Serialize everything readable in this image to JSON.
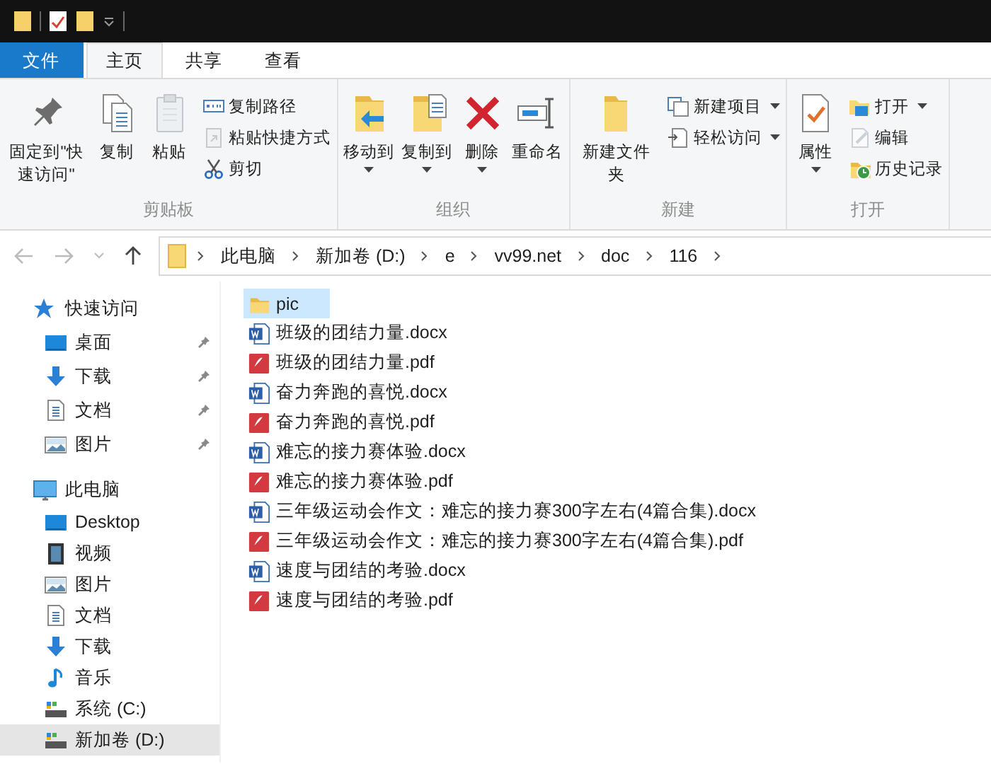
{
  "ribbon_tabs": [
    {
      "label": "文件",
      "kind": "menu",
      "selected": false
    },
    {
      "label": "主页",
      "kind": "tab",
      "selected": true
    },
    {
      "label": "共享",
      "kind": "tab",
      "selected": false
    },
    {
      "label": "查看",
      "kind": "tab",
      "selected": false
    }
  ],
  "ribbon_groups": [
    {
      "label": "剪贴板",
      "columns": [
        {
          "kind": "large",
          "items": [
            {
              "label": "固定到\"快速访问\"",
              "kind": "pin",
              "disabled": false,
              "dropdown": false
            }
          ]
        },
        {
          "kind": "large",
          "items": [
            {
              "label": "复制",
              "kind": "copy",
              "disabled": false,
              "dropdown": false
            }
          ]
        },
        {
          "kind": "large",
          "items": [
            {
              "label": "粘贴",
              "kind": "paste",
              "disabled": true,
              "dropdown": false
            }
          ]
        },
        {
          "kind": "stack",
          "items": [
            {
              "label": "复制路径",
              "kind": "copypath",
              "disabled": false,
              "dropdown": false
            },
            {
              "label": "粘贴快捷方式",
              "kind": "pasteshortcut",
              "disabled": true,
              "dropdown": false
            },
            {
              "label": "剪切",
              "kind": "cut",
              "disabled": false,
              "dropdown": false
            }
          ]
        }
      ]
    },
    {
      "label": "组织",
      "columns": [
        {
          "kind": "large",
          "items": [
            {
              "label": "移动到",
              "kind": "moveto",
              "disabled": false,
              "dropdown": true
            }
          ]
        },
        {
          "kind": "large",
          "items": [
            {
              "label": "复制到",
              "kind": "copyto",
              "disabled": false,
              "dropdown": true
            }
          ]
        },
        {
          "kind": "large",
          "items": [
            {
              "label": "删除",
              "kind": "delete",
              "disabled": false,
              "dropdown": true
            }
          ]
        },
        {
          "kind": "large",
          "items": [
            {
              "label": "重命名",
              "kind": "rename",
              "disabled": false,
              "dropdown": false
            }
          ]
        }
      ]
    },
    {
      "label": "新建",
      "columns": [
        {
          "kind": "large",
          "items": [
            {
              "label": "新建文件夹",
              "kind": "newfolder",
              "disabled": false,
              "dropdown": false
            }
          ]
        },
        {
          "kind": "stack",
          "items": [
            {
              "label": "新建项目",
              "kind": "newitem",
              "disabled": false,
              "dropdown": true
            },
            {
              "label": "轻松访问",
              "kind": "easyaccess",
              "disabled": false,
              "dropdown": true
            }
          ]
        }
      ]
    },
    {
      "label": "打开",
      "columns": [
        {
          "kind": "large",
          "items": [
            {
              "label": "属性",
              "kind": "properties",
              "disabled": false,
              "dropdown": true
            }
          ]
        },
        {
          "kind": "stack",
          "items": [
            {
              "label": "打开",
              "kind": "open",
              "disabled": false,
              "dropdown": true
            },
            {
              "label": "编辑",
              "kind": "edit",
              "disabled": true,
              "dropdown": false
            },
            {
              "label": "历史记录",
              "kind": "history",
              "disabled": false,
              "dropdown": false
            }
          ]
        }
      ]
    }
  ],
  "address_bar": {
    "path": [
      "此电脑",
      "新加卷 (D:)",
      "e",
      "vv99.net",
      "doc",
      "116"
    ]
  },
  "navigation_pane": [
    {
      "label": "快速访问",
      "kind": "star",
      "selected": false,
      "children": [
        {
          "label": "桌面",
          "kind": "desktop",
          "pinned": true,
          "selected": false
        },
        {
          "label": "下载",
          "kind": "download",
          "pinned": true,
          "selected": false
        },
        {
          "label": "文档",
          "kind": "documents",
          "pinned": true,
          "selected": false
        },
        {
          "label": "图片",
          "kind": "pictures",
          "pinned": true,
          "selected": false
        }
      ]
    },
    {
      "label": "此电脑",
      "kind": "pc",
      "selected": false,
      "children": [
        {
          "label": "Desktop",
          "kind": "desktop",
          "pinned": false,
          "selected": false
        },
        {
          "label": "视频",
          "kind": "videos",
          "pinned": false,
          "selected": false
        },
        {
          "label": "图片",
          "kind": "pictures",
          "pinned": false,
          "selected": false
        },
        {
          "label": "文档",
          "kind": "documents",
          "pinned": false,
          "selected": false
        },
        {
          "label": "下载",
          "kind": "download",
          "pinned": false,
          "selected": false
        },
        {
          "label": "音乐",
          "kind": "music",
          "pinned": false,
          "selected": false
        },
        {
          "label": "系统 (C:)",
          "kind": "drive",
          "pinned": false,
          "selected": false
        },
        {
          "label": "新加卷 (D:)",
          "kind": "drive",
          "pinned": false,
          "selected": true
        }
      ]
    }
  ],
  "files": [
    {
      "name": "pic",
      "kind": "folder",
      "selected": true
    },
    {
      "name": "班级的团结力量.docx",
      "kind": "docx",
      "selected": false
    },
    {
      "name": "班级的团结力量.pdf",
      "kind": "pdf",
      "selected": false
    },
    {
      "name": "奋力奔跑的喜悦.docx",
      "kind": "docx",
      "selected": false
    },
    {
      "name": "奋力奔跑的喜悦.pdf",
      "kind": "pdf",
      "selected": false
    },
    {
      "name": "难忘的接力赛体验.docx",
      "kind": "docx",
      "selected": false
    },
    {
      "name": "难忘的接力赛体验.pdf",
      "kind": "pdf",
      "selected": false
    },
    {
      "name": "三年级运动会作文：难忘的接力赛300字左右(4篇合集).docx",
      "kind": "docx",
      "selected": false
    },
    {
      "name": "三年级运动会作文：难忘的接力赛300字左右(4篇合集).pdf",
      "kind": "pdf",
      "selected": false
    },
    {
      "name": "速度与团结的考验.docx",
      "kind": "docx",
      "selected": false
    },
    {
      "name": "速度与团结的考验.pdf",
      "kind": "pdf",
      "selected": false
    }
  ]
}
